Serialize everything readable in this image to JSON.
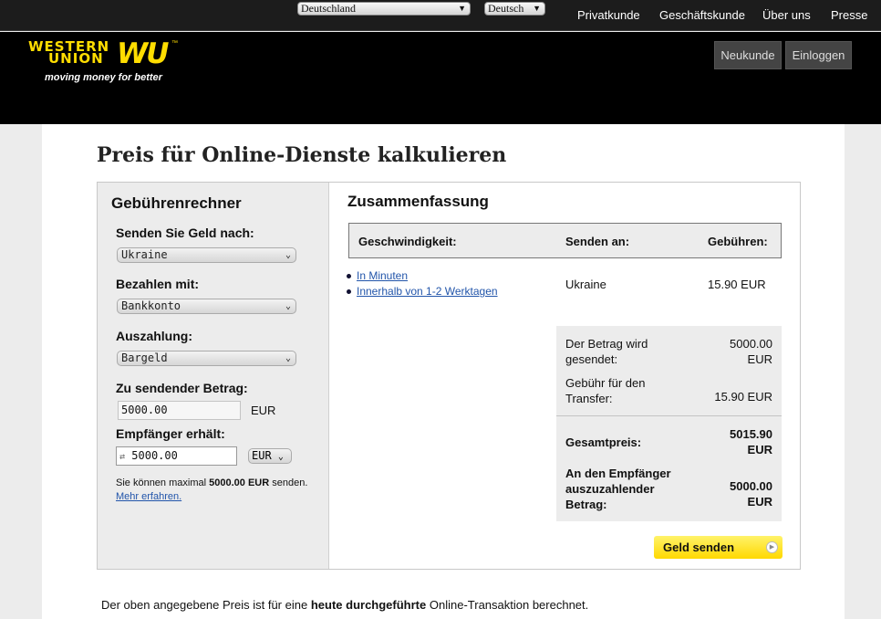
{
  "topbar": {
    "country_select": "Deutschland",
    "language_select": "Deutsch",
    "nav": [
      "Privatkunde",
      "Geschäftskunde",
      "Über uns",
      "Presse"
    ]
  },
  "header": {
    "logo_line1": "WESTERN",
    "logo_line2": "UNION",
    "logo_mark": "WU",
    "logo_tm": "™",
    "tagline": "moving money for better",
    "buttons": {
      "register": "Neukunde",
      "login": "Einloggen"
    }
  },
  "page_title": "Preis für Online-Dienste kalkulieren",
  "calculator": {
    "title": "Gebührenrechner",
    "send_to": {
      "label": "Senden Sie Geld nach:",
      "value": "Ukraine"
    },
    "pay_with": {
      "label": "Bezahlen mit:",
      "value": "Bankkonto"
    },
    "payout": {
      "label": "Auszahlung:",
      "value": "Bargeld"
    },
    "send_amount": {
      "label": "Zu sendender Betrag:",
      "value": "5000.00",
      "currency": "EUR"
    },
    "receive_amount": {
      "label": "Empfänger erhält:",
      "swap_icon": "⇄",
      "value": "5000.00",
      "currency": "EUR"
    },
    "note": {
      "prefix": "Sie können maximal",
      "amount": "5000.00 EUR",
      "suffix": "senden.",
      "link": "Mehr erfahren."
    }
  },
  "summary": {
    "title": "Zusammenfassung",
    "headers": {
      "speed": "Geschwindigkeit:",
      "send_to": "Senden an:",
      "fees": "Gebühren:"
    },
    "speed_options": [
      "In Minuten",
      "Innerhalb von 1-2 Werktagen"
    ],
    "destination": "Ukraine",
    "fee": "15.90 EUR",
    "rows": [
      {
        "label": "Der Betrag wird gesendet:",
        "value": "5000.00 EUR"
      },
      {
        "label": "Gebühr für den Transfer:",
        "value": "15.90 EUR"
      },
      {
        "label": "Gesamtpreis:",
        "value": "5015.90 EUR"
      },
      {
        "label": "An den Empfänger auszuzahlender Betrag:",
        "value": "5000.00 EUR"
      }
    ],
    "send_button": "Geld senden"
  },
  "footer_note": {
    "prefix": "Der oben angegebene Preis ist für eine",
    "bold": "heute durchgeführte",
    "suffix": "Online-Transaktion berechnet."
  }
}
